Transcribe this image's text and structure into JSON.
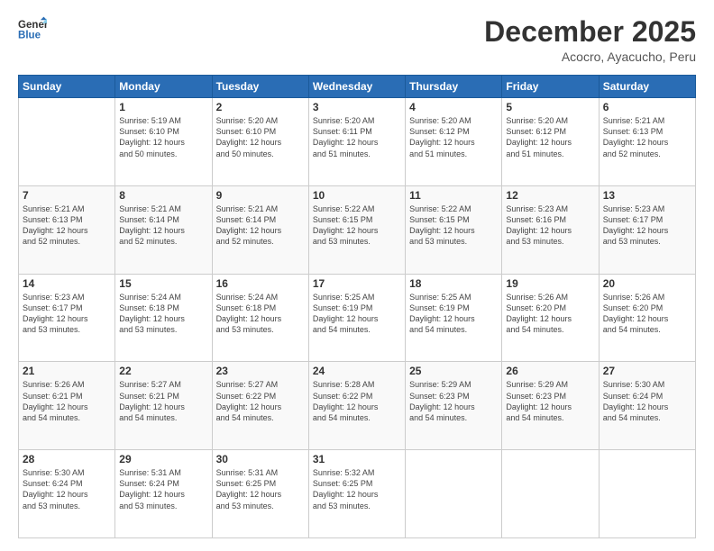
{
  "logo": {
    "line1": "General",
    "line2": "Blue"
  },
  "title": "December 2025",
  "location": "Acocro, Ayacucho, Peru",
  "days_of_week": [
    "Sunday",
    "Monday",
    "Tuesday",
    "Wednesday",
    "Thursday",
    "Friday",
    "Saturday"
  ],
  "weeks": [
    [
      {
        "day": "",
        "info": ""
      },
      {
        "day": "1",
        "info": "Sunrise: 5:19 AM\nSunset: 6:10 PM\nDaylight: 12 hours\nand 50 minutes."
      },
      {
        "day": "2",
        "info": "Sunrise: 5:20 AM\nSunset: 6:10 PM\nDaylight: 12 hours\nand 50 minutes."
      },
      {
        "day": "3",
        "info": "Sunrise: 5:20 AM\nSunset: 6:11 PM\nDaylight: 12 hours\nand 51 minutes."
      },
      {
        "day": "4",
        "info": "Sunrise: 5:20 AM\nSunset: 6:12 PM\nDaylight: 12 hours\nand 51 minutes."
      },
      {
        "day": "5",
        "info": "Sunrise: 5:20 AM\nSunset: 6:12 PM\nDaylight: 12 hours\nand 51 minutes."
      },
      {
        "day": "6",
        "info": "Sunrise: 5:21 AM\nSunset: 6:13 PM\nDaylight: 12 hours\nand 52 minutes."
      }
    ],
    [
      {
        "day": "7",
        "info": "Sunrise: 5:21 AM\nSunset: 6:13 PM\nDaylight: 12 hours\nand 52 minutes."
      },
      {
        "day": "8",
        "info": "Sunrise: 5:21 AM\nSunset: 6:14 PM\nDaylight: 12 hours\nand 52 minutes."
      },
      {
        "day": "9",
        "info": "Sunrise: 5:21 AM\nSunset: 6:14 PM\nDaylight: 12 hours\nand 52 minutes."
      },
      {
        "day": "10",
        "info": "Sunrise: 5:22 AM\nSunset: 6:15 PM\nDaylight: 12 hours\nand 53 minutes."
      },
      {
        "day": "11",
        "info": "Sunrise: 5:22 AM\nSunset: 6:15 PM\nDaylight: 12 hours\nand 53 minutes."
      },
      {
        "day": "12",
        "info": "Sunrise: 5:23 AM\nSunset: 6:16 PM\nDaylight: 12 hours\nand 53 minutes."
      },
      {
        "day": "13",
        "info": "Sunrise: 5:23 AM\nSunset: 6:17 PM\nDaylight: 12 hours\nand 53 minutes."
      }
    ],
    [
      {
        "day": "14",
        "info": "Sunrise: 5:23 AM\nSunset: 6:17 PM\nDaylight: 12 hours\nand 53 minutes."
      },
      {
        "day": "15",
        "info": "Sunrise: 5:24 AM\nSunset: 6:18 PM\nDaylight: 12 hours\nand 53 minutes."
      },
      {
        "day": "16",
        "info": "Sunrise: 5:24 AM\nSunset: 6:18 PM\nDaylight: 12 hours\nand 53 minutes."
      },
      {
        "day": "17",
        "info": "Sunrise: 5:25 AM\nSunset: 6:19 PM\nDaylight: 12 hours\nand 54 minutes."
      },
      {
        "day": "18",
        "info": "Sunrise: 5:25 AM\nSunset: 6:19 PM\nDaylight: 12 hours\nand 54 minutes."
      },
      {
        "day": "19",
        "info": "Sunrise: 5:26 AM\nSunset: 6:20 PM\nDaylight: 12 hours\nand 54 minutes."
      },
      {
        "day": "20",
        "info": "Sunrise: 5:26 AM\nSunset: 6:20 PM\nDaylight: 12 hours\nand 54 minutes."
      }
    ],
    [
      {
        "day": "21",
        "info": "Sunrise: 5:26 AM\nSunset: 6:21 PM\nDaylight: 12 hours\nand 54 minutes."
      },
      {
        "day": "22",
        "info": "Sunrise: 5:27 AM\nSunset: 6:21 PM\nDaylight: 12 hours\nand 54 minutes."
      },
      {
        "day": "23",
        "info": "Sunrise: 5:27 AM\nSunset: 6:22 PM\nDaylight: 12 hours\nand 54 minutes."
      },
      {
        "day": "24",
        "info": "Sunrise: 5:28 AM\nSunset: 6:22 PM\nDaylight: 12 hours\nand 54 minutes."
      },
      {
        "day": "25",
        "info": "Sunrise: 5:29 AM\nSunset: 6:23 PM\nDaylight: 12 hours\nand 54 minutes."
      },
      {
        "day": "26",
        "info": "Sunrise: 5:29 AM\nSunset: 6:23 PM\nDaylight: 12 hours\nand 54 minutes."
      },
      {
        "day": "27",
        "info": "Sunrise: 5:30 AM\nSunset: 6:24 PM\nDaylight: 12 hours\nand 54 minutes."
      }
    ],
    [
      {
        "day": "28",
        "info": "Sunrise: 5:30 AM\nSunset: 6:24 PM\nDaylight: 12 hours\nand 53 minutes."
      },
      {
        "day": "29",
        "info": "Sunrise: 5:31 AM\nSunset: 6:24 PM\nDaylight: 12 hours\nand 53 minutes."
      },
      {
        "day": "30",
        "info": "Sunrise: 5:31 AM\nSunset: 6:25 PM\nDaylight: 12 hours\nand 53 minutes."
      },
      {
        "day": "31",
        "info": "Sunrise: 5:32 AM\nSunset: 6:25 PM\nDaylight: 12 hours\nand 53 minutes."
      },
      {
        "day": "",
        "info": ""
      },
      {
        "day": "",
        "info": ""
      },
      {
        "day": "",
        "info": ""
      }
    ]
  ]
}
